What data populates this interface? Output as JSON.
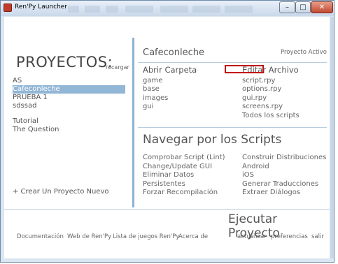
{
  "window": {
    "title": "Ren'Py Launcher",
    "buttons": {
      "minimize": "–",
      "maximize": "□",
      "close": "✕"
    }
  },
  "projects": {
    "heading": "PROYECTOS:",
    "refresh": "recargar",
    "items": [
      "AS",
      "Cafeconleche",
      "PRUEBA 1",
      "sdssad"
    ],
    "tutorials": [
      "Tutorial",
      "The Question"
    ],
    "new_project": "+ Crear Un Proyecto Nuevo"
  },
  "project": {
    "name": "Cafeconleche",
    "active_label": "Proyecto Activo",
    "open_folder": "Abrir Carpeta",
    "folders": [
      "game",
      "base",
      "images",
      "gui"
    ],
    "edit_file": "Editar Archivo",
    "files": [
      "script.rpy",
      "options.rpy",
      "gui.rpy",
      "screens.rpy",
      "Todos los scripts"
    ]
  },
  "navigate": {
    "title": "Navegar por los Scripts",
    "left_actions": [
      "Comprobar Script (Lint)",
      "Change/Update GUI",
      "Eliminar Datos",
      "Persistentes",
      "Forzar Recompilación"
    ],
    "right_actions": [
      "Construir Distribuciones",
      "Android",
      "iOS",
      "Generar Traducciones",
      "Extraer Diálogos"
    ]
  },
  "launch": "Ejecutar Proyecto",
  "footer": {
    "links": [
      "Documentación",
      "Web de Ren'Py",
      "Lista de juegos Ren'Py",
      "Acerca de"
    ],
    "right": [
      "actualizar",
      "preferencias",
      "salir"
    ]
  },
  "colors": {
    "accent": "#8db2d2",
    "selected": "#92b6d6",
    "highlight_box": "#c10f0f"
  }
}
